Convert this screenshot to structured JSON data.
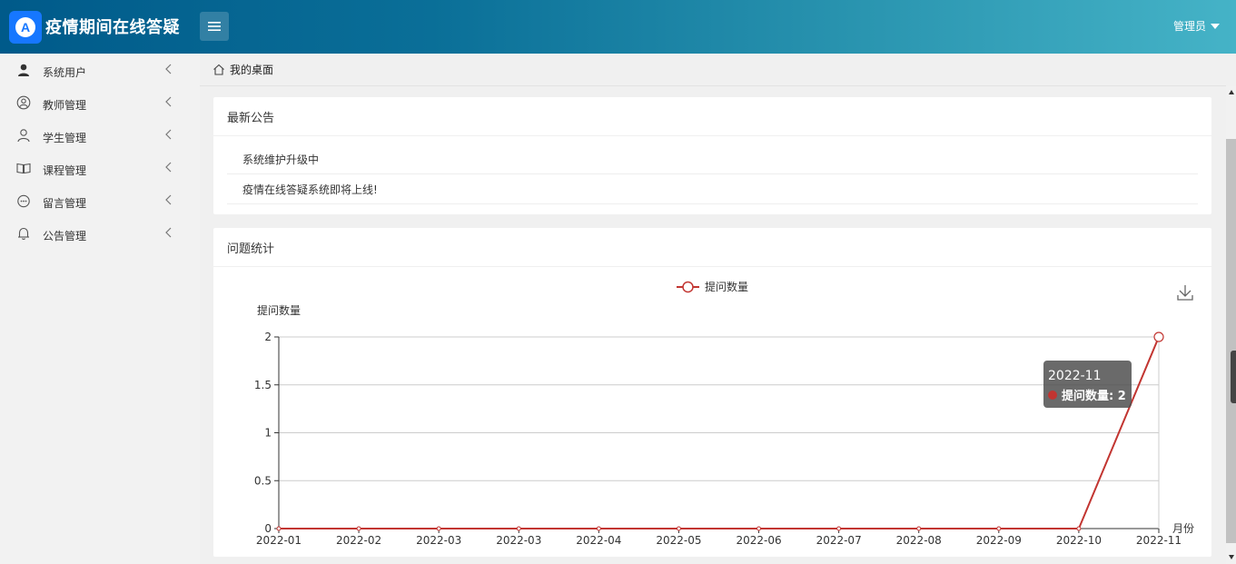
{
  "header": {
    "logo_letter": "A",
    "app_title": "疫情期间在线答疑",
    "user_label": "管理员"
  },
  "sidebar": {
    "items": [
      {
        "label": "系统用户",
        "icon": "user-filled-icon"
      },
      {
        "label": "教师管理",
        "icon": "user-circle-icon"
      },
      {
        "label": "学生管理",
        "icon": "user-outline-icon"
      },
      {
        "label": "课程管理",
        "icon": "book-icon"
      },
      {
        "label": "留言管理",
        "icon": "message-icon"
      },
      {
        "label": "公告管理",
        "icon": "bell-icon"
      }
    ]
  },
  "breadcrumb": {
    "home_label": "我的桌面"
  },
  "notices_card": {
    "title": "最新公告",
    "items": [
      "系统维护升级中",
      "疫情在线答疑系统即将上线!"
    ]
  },
  "stats_card": {
    "title": "问题统计"
  },
  "colors": {
    "accent": "#1677ff",
    "series": "#c23531"
  },
  "chart_data": {
    "type": "line",
    "categories": [
      "2022-01",
      "2022-02",
      "2022-03",
      "2022-03",
      "2022-04",
      "2022-05",
      "2022-06",
      "2022-07",
      "2022-08",
      "2022-09",
      "2022-10",
      "2022-11"
    ],
    "series": [
      {
        "name": "提问数量",
        "values": [
          0,
          0,
          0,
          0,
          0,
          0,
          0,
          0,
          0,
          0,
          0,
          2
        ]
      }
    ],
    "xlabel": "月份",
    "ylabel": "提问数量",
    "ylim": [
      0,
      2
    ],
    "yticks": [
      "0",
      "0.5",
      "1",
      "1.5",
      "2"
    ],
    "grid": true,
    "legend": "top-center",
    "tooltip": {
      "title": "2022-11",
      "label": "提问数量: 2"
    }
  }
}
